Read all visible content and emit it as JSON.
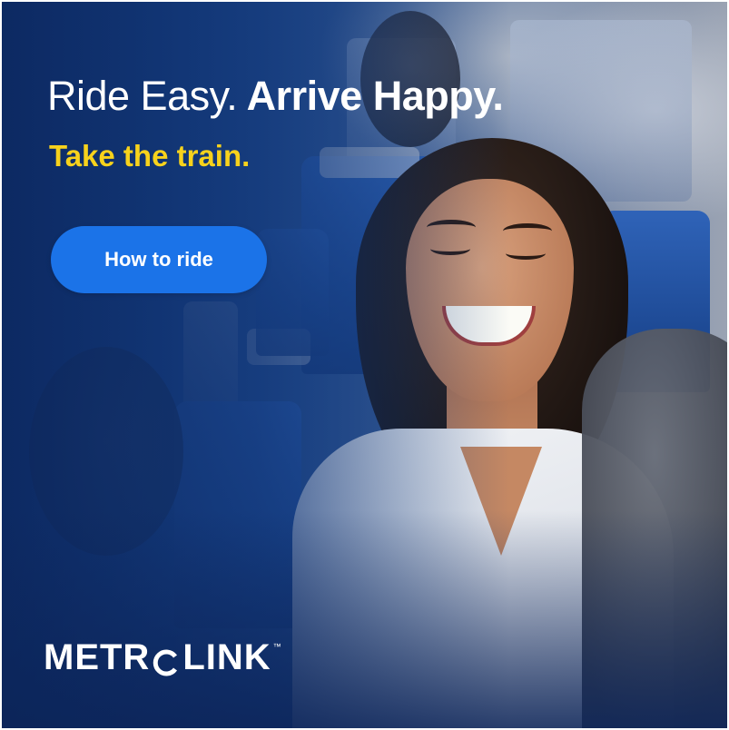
{
  "ad": {
    "headline_light": "Ride Easy.",
    "headline_bold": "Arrive Happy.",
    "tagline": "Take the train.",
    "cta_label": "How to ride",
    "logo": {
      "text_before": "METR",
      "text_after": "LINK",
      "trademark": "™"
    }
  },
  "colors": {
    "accent_yellow": "#f7d21c",
    "cta_blue": "#1b73e8",
    "background_blue": "#1d3f7c"
  },
  "icons": {
    "logo_o": "metrolink-o-mark"
  }
}
